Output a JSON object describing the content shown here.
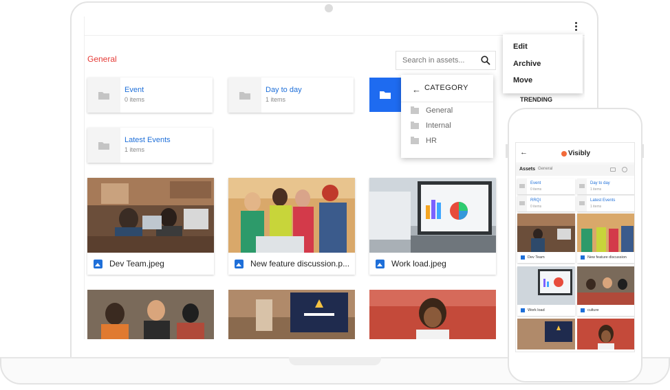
{
  "laptop": {
    "section_title": "General",
    "search": {
      "placeholder": "Search in assets..."
    },
    "folders": [
      {
        "name": "Event",
        "count": "0 items"
      },
      {
        "name": "Day to day",
        "count": "1 items"
      },
      {
        "name": "Latest Events",
        "count": "1 items"
      }
    ],
    "category_menu": {
      "title": "CATEGORY",
      "items": [
        "General",
        "Internal",
        "HR"
      ]
    },
    "context_menu": {
      "items": [
        "Edit",
        "Archive",
        "Move"
      ]
    },
    "trending_label": "TRENDING",
    "assets": [
      {
        "name": "Dev Team.jpeg"
      },
      {
        "name": "New feature discussion.p..."
      },
      {
        "name": "Work load.jpeg"
      }
    ]
  },
  "phone": {
    "brand": "Visibly",
    "assets_label": "Assets",
    "breadcrumb": "General",
    "folders": [
      {
        "name": "Event",
        "count": "0 items"
      },
      {
        "name": "Day to day",
        "count": "1 items"
      },
      {
        "name": "RRQI",
        "count": "0 items"
      },
      {
        "name": "Latest Events",
        "count": "1 items"
      }
    ],
    "assets": [
      {
        "name": "Dev Team"
      },
      {
        "name": "New feature discussion"
      },
      {
        "name": "Work load"
      },
      {
        "name": "culture"
      }
    ]
  },
  "colors": {
    "accent_blue": "#1e6bf0",
    "link_blue": "#1e6fd9",
    "section_red": "#e53935",
    "logo_orange": "#f26b3a"
  }
}
